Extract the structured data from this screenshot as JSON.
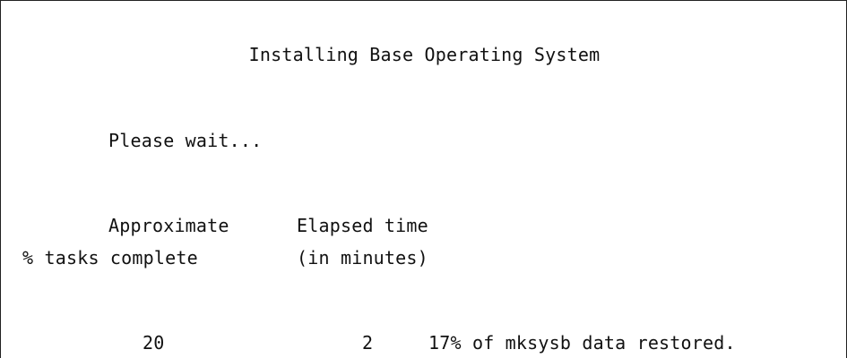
{
  "screen": {
    "title": "Installing Base Operating System",
    "wait_message": "Please wait...",
    "columns": {
      "tasks_header_line1": "Approximate",
      "tasks_header_line2": "% tasks complete",
      "time_header_line1": "Elapsed time",
      "time_header_line2": "(in minutes)"
    },
    "progress": {
      "percent_complete": "20",
      "elapsed_minutes": "2",
      "status_message": "17% of mksysb data restored."
    }
  }
}
